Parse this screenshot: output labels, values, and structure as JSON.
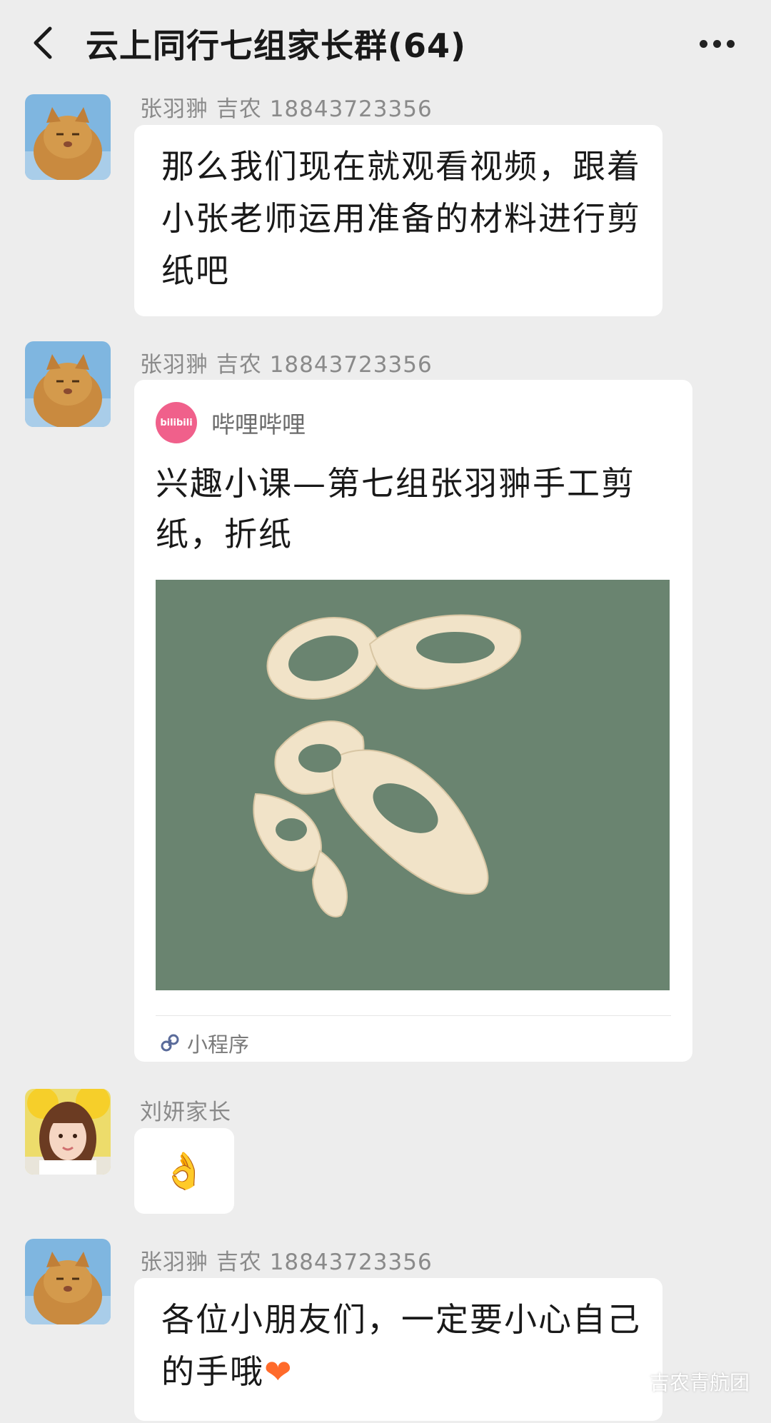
{
  "header": {
    "title": "云上同行七组家长群(64)"
  },
  "messages": [
    {
      "sender": "张羽翀 吉农 18843723356",
      "text": "那么我们现在就观看视频，跟着小张老师运用准备的材料进行剪纸吧"
    },
    {
      "sender": "张羽翀 吉农 18843723356",
      "card": {
        "source_logo": "bilibili",
        "source_name": "哔哩哔哩",
        "title": "兴趣小课—第七组张羽翀手工剪纸，折纸",
        "footer_label": "小程序"
      }
    },
    {
      "sender": "刘妍家长",
      "emoji": "👌"
    },
    {
      "sender": "张羽翀 吉农 18843723356",
      "text": "各位小朋友们，一定要小心自己的手哦",
      "emoji": "❤"
    }
  ],
  "watermark": {
    "text": "吉农青航团"
  },
  "colors": {
    "background": "#ededed",
    "bubble": "#ffffff",
    "bilibili_pink": "#f0608b",
    "sender_gray": "#8a8a8a",
    "card_image_bg": "#6a8470"
  }
}
